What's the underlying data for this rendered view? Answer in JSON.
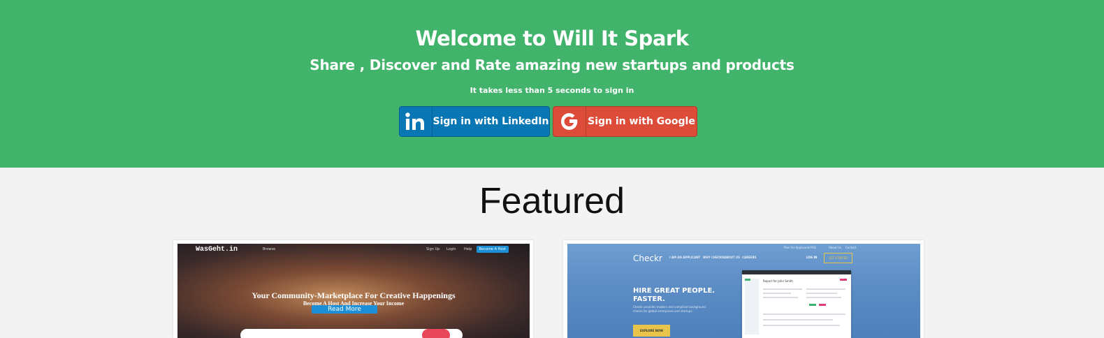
{
  "hero": {
    "title": "Welcome to Will It Spark",
    "subtitle": "Share , Discover and Rate amazing new startups and products",
    "hint": "It takes less than 5 seconds to sign in",
    "linkedin_label": "Sign in with LinkedIn",
    "google_label": "Sign in with Google"
  },
  "colors": {
    "hero_bg": "#41b36b",
    "linkedin": "#0a77b5",
    "google": "#dd4b39",
    "page_bg": "#f2f3f2"
  },
  "featured": {
    "title": "Featured",
    "cards": [
      {
        "logo": "WasGeht.in",
        "nav_browse": "Browse",
        "nav_signup": "Sign Up",
        "nav_login": "Login",
        "nav_help": "Help",
        "host_button": "Become A Host",
        "headline": "Your Community-Marketplace For Creative Happenings",
        "sub": "Become A Host And Increase Your Income",
        "cta": "Read More"
      },
      {
        "logo": "Checkr",
        "nav_applicant": "I AM AN APPLICANT",
        "nav_whychecks": "WHY CHECKR",
        "nav_about": "ABOUT US",
        "nav_careers": "CAREERS",
        "top_applicants": "Plan for Applicants",
        "top_faq": "FAQ",
        "top_about": "About Us",
        "top_contact": "Contact",
        "login": "LOG IN",
        "get_started": "GET STARTED",
        "headline": "HIRE GREAT PEOPLE. FASTER.",
        "desc": "Checkr provides modern and compliant background checks for global enterprises and startups.",
        "cta": "EXPLORE NOW",
        "report_title": "Report for John Smith"
      }
    ]
  },
  "icons": {
    "linkedin": "linkedin-icon",
    "google": "google-icon"
  }
}
